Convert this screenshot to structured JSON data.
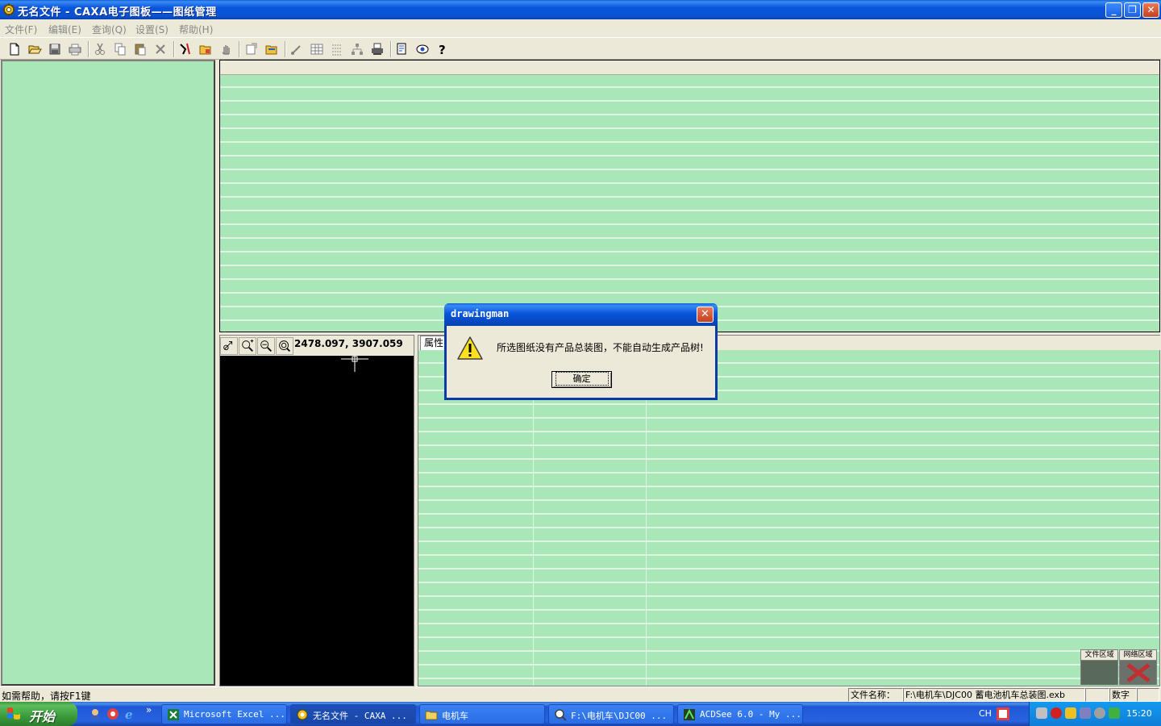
{
  "window": {
    "title": "无名文件 - CAXA电子图板——图纸管理",
    "buttons": {
      "minimize": "_",
      "restore": "❐",
      "close": "✕"
    }
  },
  "menubar": {
    "items": [
      "文件(F)",
      "编辑(E)",
      "查询(Q)",
      "设置(S)",
      "帮助(H)"
    ]
  },
  "toolbar": {
    "icons": [
      "new-icon",
      "open-icon",
      "save-icon",
      "print-icon",
      "cut-icon",
      "copy-icon",
      "paste-icon",
      "delete-icon",
      "hammer-icon",
      "folder-add-icon",
      "hand-icon",
      "export-icon",
      "import-icon",
      "brush-icon",
      "table-icon",
      "list-icon",
      "tree-icon",
      "printer-icon",
      "document-search-icon",
      "view-icon",
      "help-icon"
    ]
  },
  "preview": {
    "coords": "2478.097, 3907.059",
    "tools": [
      "pan-icon",
      "zoom-window-icon",
      "zoom-icon",
      "zoom-all-icon"
    ]
  },
  "properties": {
    "tab_label": "属性"
  },
  "regions": {
    "file_area": "文件区域",
    "network_area": "网络区域"
  },
  "statusbar": {
    "help_text": "如需帮助，请按F1键",
    "filename_label": "文件名称：",
    "filename_value": "F:\\电机车\\DJC00 蓄电池机车总装图.exb",
    "num_indicator": "数字"
  },
  "dialog": {
    "title": "drawingman",
    "message": "所选图纸没有产品总装图，不能自动生成产品树!",
    "ok_label": "确定",
    "close_label": "✕"
  },
  "taskbar": {
    "start_label": "开始",
    "tasks": [
      {
        "label": "Microsoft Excel ...",
        "icon": "excel-icon"
      },
      {
        "label": "无名文件 - CAXA ...",
        "icon": "caxa-icon"
      },
      {
        "label": "电机车",
        "icon": "folder-icon"
      },
      {
        "label": "F:\\电机车\\DJC00 ...",
        "icon": "search-icon"
      },
      {
        "label": "ACDSee 6.0 - My ...",
        "icon": "acdsee-icon"
      }
    ],
    "language": "CH",
    "clock": "15:20",
    "overflow": "»"
  },
  "colors": {
    "panel_green": "#a9e6b8",
    "xp_blue": "#0855dd",
    "start_green": "#3a9b3a"
  }
}
